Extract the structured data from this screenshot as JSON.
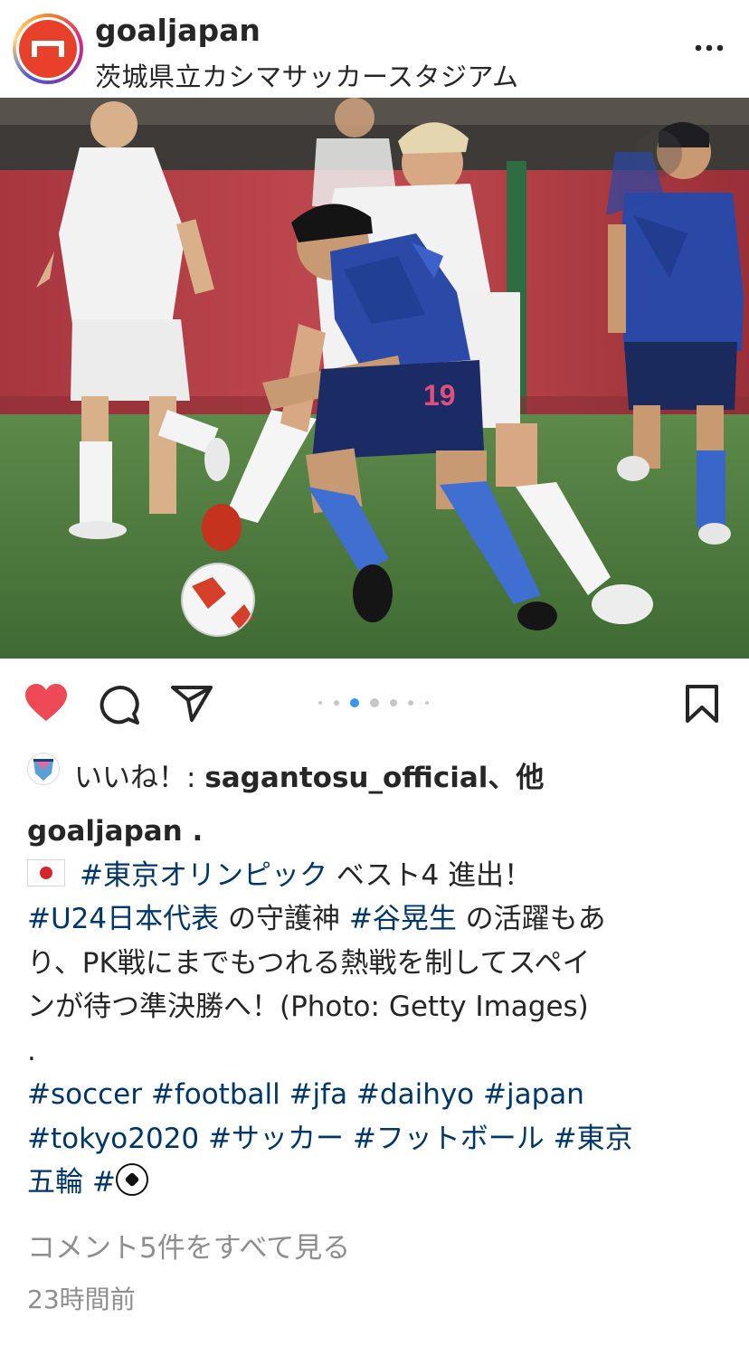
{
  "header": {
    "username": "goaljapan",
    "location": "茨城県立カシマサッカースタジアム",
    "more_icon": "more-horizontal-icon"
  },
  "photo": {
    "jersey_number_front": "19",
    "colors": {
      "pitch": "#4f7a3f",
      "stands": "#b8424a",
      "japan_kit": "#1f3a94",
      "nz_kit": "#f2f2f2"
    }
  },
  "actions": {
    "like_icon": "heart-filled-icon",
    "comment_icon": "comment-icon",
    "share_icon": "send-icon",
    "save_icon": "bookmark-icon",
    "carousel": {
      "count": 7,
      "active_index": 2
    },
    "like_color": "#ed4956"
  },
  "likes": {
    "prefix": "いいね！: ",
    "user": "sagantosu_official",
    "suffix": "、他"
  },
  "caption": {
    "username": "goaljapan",
    "username_suffix": " .",
    "line1_tag": "#東京オリンピック",
    "line1_text": " ベスト4 進出！",
    "line2_tag1": "#U24日本代表",
    "line2_text1": " の守護神 ",
    "line2_tag2": "#谷晃生",
    "line2_text2": " の活躍もあ",
    "line3": "り、PK戦にまでもつれる熱戦を制してスペイ",
    "line4": "ンが待つ準決勝へ！(Photo: Getty Images)",
    "line5": ".",
    "line6": "#soccer #football #jfa #daihyo #japan",
    "line7": "#tokyo2020 #サッカー #フットボール #東京",
    "line8": "五輪 #"
  },
  "view_comments": "コメント5件をすべて見る",
  "timestamp": "23時間前"
}
